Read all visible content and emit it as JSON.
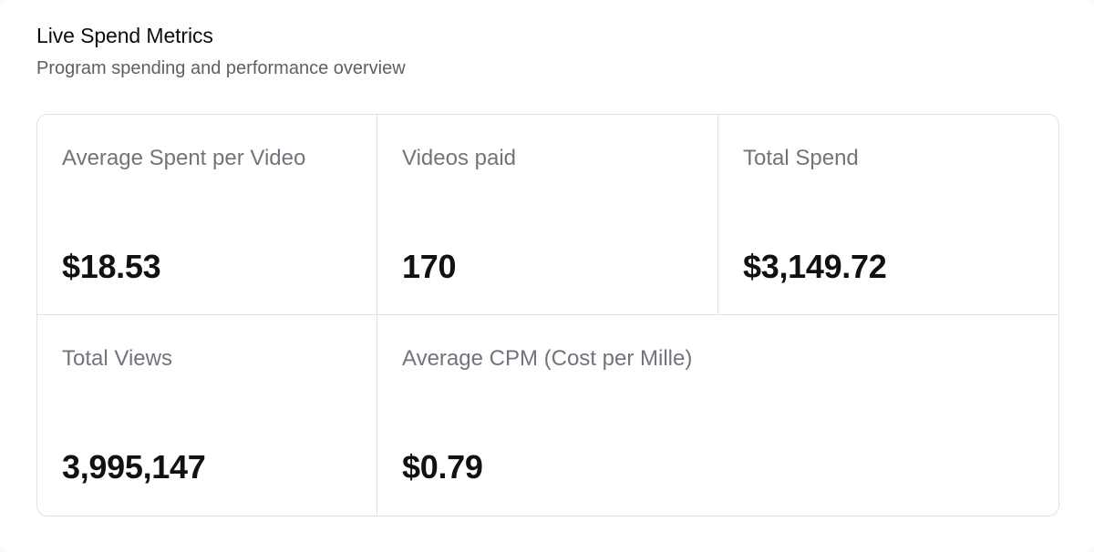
{
  "header": {
    "title": "Live Spend Metrics",
    "subtitle": "Program spending and performance overview"
  },
  "metrics": [
    {
      "label": "Average Spent per Video",
      "value": "$18.53"
    },
    {
      "label": "Videos paid",
      "value": "170"
    },
    {
      "label": "Total Spend",
      "value": "$3,149.72"
    },
    {
      "label": "Total Views",
      "value": "3,995,147"
    },
    {
      "label": "Average CPM (Cost per Mille)",
      "value": "$0.79"
    }
  ],
  "colors": {
    "title": "#0d0d0d",
    "subtitle": "#5f5f5f",
    "label": "#74737c",
    "value": "#111111",
    "border": "#e1e1e1"
  }
}
